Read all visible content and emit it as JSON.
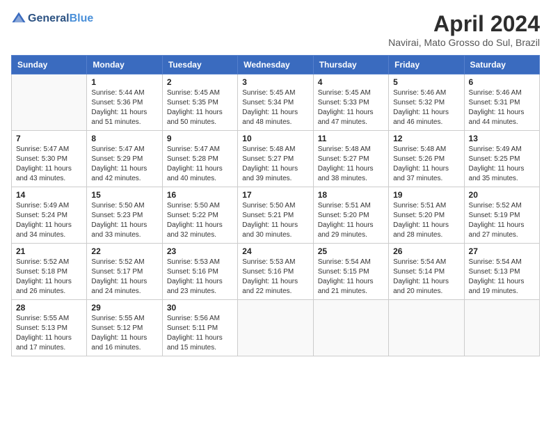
{
  "header": {
    "logo_line1": "General",
    "logo_line2": "Blue",
    "month": "April 2024",
    "location": "Navirai, Mato Grosso do Sul, Brazil"
  },
  "weekdays": [
    "Sunday",
    "Monday",
    "Tuesday",
    "Wednesday",
    "Thursday",
    "Friday",
    "Saturday"
  ],
  "weeks": [
    [
      {
        "day": "",
        "empty": true
      },
      {
        "day": "1",
        "sunrise": "5:44 AM",
        "sunset": "5:36 PM",
        "daylight": "11 hours and 51 minutes."
      },
      {
        "day": "2",
        "sunrise": "5:45 AM",
        "sunset": "5:35 PM",
        "daylight": "11 hours and 50 minutes."
      },
      {
        "day": "3",
        "sunrise": "5:45 AM",
        "sunset": "5:34 PM",
        "daylight": "11 hours and 48 minutes."
      },
      {
        "day": "4",
        "sunrise": "5:45 AM",
        "sunset": "5:33 PM",
        "daylight": "11 hours and 47 minutes."
      },
      {
        "day": "5",
        "sunrise": "5:46 AM",
        "sunset": "5:32 PM",
        "daylight": "11 hours and 46 minutes."
      },
      {
        "day": "6",
        "sunrise": "5:46 AM",
        "sunset": "5:31 PM",
        "daylight": "11 hours and 44 minutes."
      }
    ],
    [
      {
        "day": "7",
        "sunrise": "5:47 AM",
        "sunset": "5:30 PM",
        "daylight": "11 hours and 43 minutes."
      },
      {
        "day": "8",
        "sunrise": "5:47 AM",
        "sunset": "5:29 PM",
        "daylight": "11 hours and 42 minutes."
      },
      {
        "day": "9",
        "sunrise": "5:47 AM",
        "sunset": "5:28 PM",
        "daylight": "11 hours and 40 minutes."
      },
      {
        "day": "10",
        "sunrise": "5:48 AM",
        "sunset": "5:27 PM",
        "daylight": "11 hours and 39 minutes."
      },
      {
        "day": "11",
        "sunrise": "5:48 AM",
        "sunset": "5:27 PM",
        "daylight": "11 hours and 38 minutes."
      },
      {
        "day": "12",
        "sunrise": "5:48 AM",
        "sunset": "5:26 PM",
        "daylight": "11 hours and 37 minutes."
      },
      {
        "day": "13",
        "sunrise": "5:49 AM",
        "sunset": "5:25 PM",
        "daylight": "11 hours and 35 minutes."
      }
    ],
    [
      {
        "day": "14",
        "sunrise": "5:49 AM",
        "sunset": "5:24 PM",
        "daylight": "11 hours and 34 minutes."
      },
      {
        "day": "15",
        "sunrise": "5:50 AM",
        "sunset": "5:23 PM",
        "daylight": "11 hours and 33 minutes."
      },
      {
        "day": "16",
        "sunrise": "5:50 AM",
        "sunset": "5:22 PM",
        "daylight": "11 hours and 32 minutes."
      },
      {
        "day": "17",
        "sunrise": "5:50 AM",
        "sunset": "5:21 PM",
        "daylight": "11 hours and 30 minutes."
      },
      {
        "day": "18",
        "sunrise": "5:51 AM",
        "sunset": "5:20 PM",
        "daylight": "11 hours and 29 minutes."
      },
      {
        "day": "19",
        "sunrise": "5:51 AM",
        "sunset": "5:20 PM",
        "daylight": "11 hours and 28 minutes."
      },
      {
        "day": "20",
        "sunrise": "5:52 AM",
        "sunset": "5:19 PM",
        "daylight": "11 hours and 27 minutes."
      }
    ],
    [
      {
        "day": "21",
        "sunrise": "5:52 AM",
        "sunset": "5:18 PM",
        "daylight": "11 hours and 26 minutes."
      },
      {
        "day": "22",
        "sunrise": "5:52 AM",
        "sunset": "5:17 PM",
        "daylight": "11 hours and 24 minutes."
      },
      {
        "day": "23",
        "sunrise": "5:53 AM",
        "sunset": "5:16 PM",
        "daylight": "11 hours and 23 minutes."
      },
      {
        "day": "24",
        "sunrise": "5:53 AM",
        "sunset": "5:16 PM",
        "daylight": "11 hours and 22 minutes."
      },
      {
        "day": "25",
        "sunrise": "5:54 AM",
        "sunset": "5:15 PM",
        "daylight": "11 hours and 21 minutes."
      },
      {
        "day": "26",
        "sunrise": "5:54 AM",
        "sunset": "5:14 PM",
        "daylight": "11 hours and 20 minutes."
      },
      {
        "day": "27",
        "sunrise": "5:54 AM",
        "sunset": "5:13 PM",
        "daylight": "11 hours and 19 minutes."
      }
    ],
    [
      {
        "day": "28",
        "sunrise": "5:55 AM",
        "sunset": "5:13 PM",
        "daylight": "11 hours and 17 minutes."
      },
      {
        "day": "29",
        "sunrise": "5:55 AM",
        "sunset": "5:12 PM",
        "daylight": "11 hours and 16 minutes."
      },
      {
        "day": "30",
        "sunrise": "5:56 AM",
        "sunset": "5:11 PM",
        "daylight": "11 hours and 15 minutes."
      },
      {
        "day": "",
        "empty": true
      },
      {
        "day": "",
        "empty": true
      },
      {
        "day": "",
        "empty": true
      },
      {
        "day": "",
        "empty": true
      }
    ]
  ]
}
